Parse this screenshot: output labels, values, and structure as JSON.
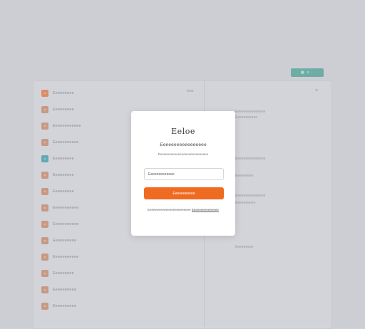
{
  "colors": {
    "page_bg": "#cfd0d5",
    "accent_orange": "#f06b22",
    "accent_teal": "#4fa597",
    "modal_bg": "#ffffff"
  },
  "toolbar": {
    "action_button": {
      "icon": "grid-icon",
      "label": "≡ ⋮"
    }
  },
  "list": {
    "header_right_label": "≡≡≡",
    "items": [
      {
        "label": "Eeeeeeeee",
        "icon": "app-icon",
        "color": "#e07a4a"
      },
      {
        "label": "Eeeeeeeee",
        "icon": "app-icon",
        "color": "#c98a6a"
      },
      {
        "label": "Eeeeeeeeeeee",
        "icon": "app-icon",
        "color": "#c98a6a"
      },
      {
        "label": "Eeeeeeeeeee",
        "icon": "app-icon",
        "color": "#c98a6a"
      },
      {
        "label": "Eeeeeeeee",
        "icon": "app-icon",
        "color": "#3fa0a8"
      },
      {
        "label": "Eeeeeeeee",
        "icon": "app-icon",
        "color": "#c98a6a"
      },
      {
        "label": "Eeeeeeeee",
        "icon": "app-icon",
        "color": "#c98a6a"
      },
      {
        "label": "Eeeeeeeeeee",
        "icon": "app-icon",
        "color": "#c98a6a"
      },
      {
        "label": "Eeeeeeeeeee",
        "icon": "app-icon",
        "color": "#c98a6a"
      },
      {
        "label": "Eeeeeeeeee",
        "icon": "app-icon",
        "color": "#c98a6a"
      },
      {
        "label": "Eeeeeeeeeee",
        "icon": "app-icon",
        "color": "#c98a6a"
      },
      {
        "label": "Eeeeeeeee",
        "icon": "app-icon",
        "color": "#c98a6a"
      },
      {
        "label": "Eeeeeeeeee",
        "icon": "app-icon",
        "color": "#c98a6a"
      },
      {
        "label": "Eeeeeeeeee",
        "icon": "app-icon",
        "color": "#c98a6a"
      }
    ]
  },
  "details": {
    "close_icon": "×",
    "lines": [
      "Eeeeeeeeeeeeeee",
      "Eeeeeeeeeee",
      "Eeeeeeeeeeeeeee",
      "Eeeeeeeee",
      "Eeeeeeeeeeeeeee",
      "Eeeeeeeeee",
      "Eeeeeeeee"
    ]
  },
  "modal": {
    "logo_text": "Eeloe",
    "title": "Eeeeeeeeeeeeeeeee",
    "subtitle": "Eeeeeeeeeeeeeeeeeeeeeeeeeeee",
    "input_value": "Eeeeeeeeeeeee",
    "button_label": "Eeeeeeeeeee",
    "footer_text": "Eeeeeeeeeeeeeeeeeeeeeeee",
    "footer_link": "Eeeeeeeeeeeeeee"
  }
}
